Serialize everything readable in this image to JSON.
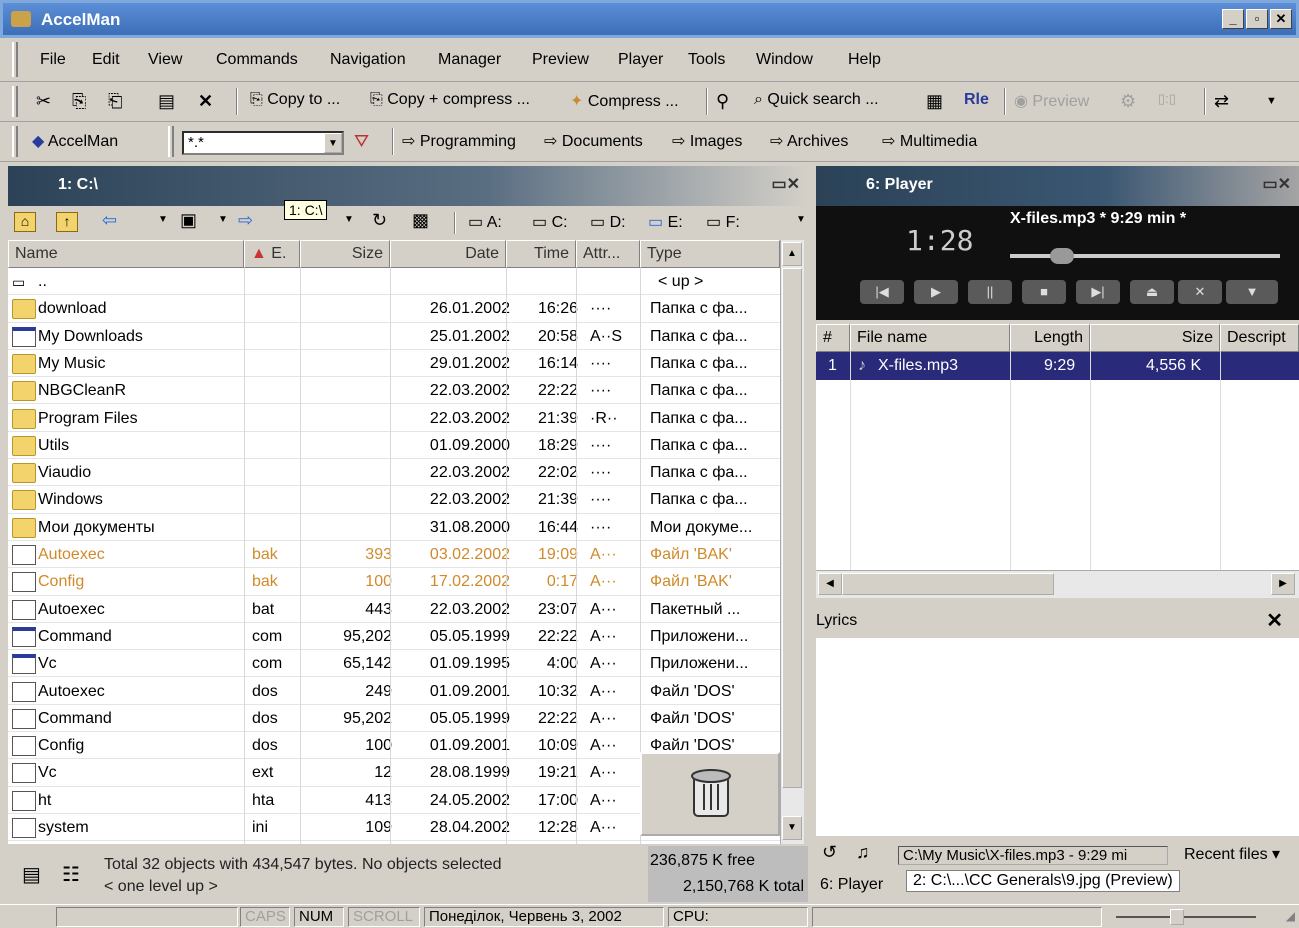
{
  "window": {
    "title": "AccelMan"
  },
  "menu": [
    "File",
    "Edit",
    "View",
    "Commands",
    "Navigation",
    "Manager",
    "Preview",
    "Player",
    "Tools",
    "Window",
    "Help"
  ],
  "toolbar1": {
    "copy_to": "Copy to ...",
    "copy_compress": "Copy + compress ...",
    "compress": "Compress ...",
    "quick_search": "Quick search ...",
    "preview": "Preview"
  },
  "toolbar2": {
    "accelman": "AccelMan",
    "filter_value": "*.*",
    "bookmarks": [
      "Programming",
      "Documents",
      "Images",
      "Archives",
      "Multimedia"
    ]
  },
  "left_panel": {
    "title": "1: C:\\",
    "path_tooltip": "1: C:\\",
    "drives": [
      "A:",
      "C:",
      "D:",
      "E:",
      "F:"
    ],
    "columns": {
      "name": "Name",
      "ext": "E.",
      "size": "Size",
      "date": "Date",
      "time": "Time",
      "attr": "Attr...",
      "type": "Type"
    },
    "up_row": {
      "name": "..",
      "type": "< up >"
    },
    "rows": [
      {
        "icon": "folder",
        "name": "download",
        "ext": "",
        "size": "",
        "date": "26.01.2002",
        "time": "16:26",
        "attr": "····",
        "type": "Папка с фа...",
        "hl": false
      },
      {
        "icon": "window",
        "name": "My Downloads",
        "ext": "",
        "size": "",
        "date": "25.01.2002",
        "time": "20:58",
        "attr": "A··S",
        "type": "Папка с фа...",
        "hl": false
      },
      {
        "icon": "folder",
        "name": "My Music",
        "ext": "",
        "size": "",
        "date": "29.01.2002",
        "time": "16:14",
        "attr": "····",
        "type": "Папка с фа...",
        "hl": false
      },
      {
        "icon": "folder",
        "name": "NBGCleanR",
        "ext": "",
        "size": "",
        "date": "22.03.2002",
        "time": "22:22",
        "attr": "····",
        "type": "Папка с фа...",
        "hl": false
      },
      {
        "icon": "folder",
        "name": "Program Files",
        "ext": "",
        "size": "",
        "date": "22.03.2002",
        "time": "21:39",
        "attr": "·R··",
        "type": "Папка с фа...",
        "hl": false
      },
      {
        "icon": "folder",
        "name": "Utils",
        "ext": "",
        "size": "",
        "date": "01.09.2000",
        "time": "18:29",
        "attr": "····",
        "type": "Папка с фа...",
        "hl": false
      },
      {
        "icon": "folder",
        "name": "Viaudio",
        "ext": "",
        "size": "",
        "date": "22.03.2002",
        "time": "22:02",
        "attr": "····",
        "type": "Папка с фа...",
        "hl": false
      },
      {
        "icon": "folder",
        "name": "Windows",
        "ext": "",
        "size": "",
        "date": "22.03.2002",
        "time": "21:39",
        "attr": "····",
        "type": "Папка с фа...",
        "hl": false
      },
      {
        "icon": "folder",
        "name": "Мои документы",
        "ext": "",
        "size": "",
        "date": "31.08.2000",
        "time": "16:44",
        "attr": "····",
        "type": "Мои докуме...",
        "hl": false
      },
      {
        "icon": "file",
        "name": "Autoexec",
        "ext": "bak",
        "size": "393",
        "date": "03.02.2002",
        "time": "19:09",
        "attr": "A···",
        "type": "Файл 'BAK'",
        "hl": true
      },
      {
        "icon": "file",
        "name": "Config",
        "ext": "bak",
        "size": "100",
        "date": "17.02.2002",
        "time": "0:17",
        "attr": "A···",
        "type": "Файл 'BAK'",
        "hl": true
      },
      {
        "icon": "file",
        "name": "Autoexec",
        "ext": "bat",
        "size": "443",
        "date": "22.03.2002",
        "time": "23:07",
        "attr": "A···",
        "type": "Пакетный ...",
        "hl": false
      },
      {
        "icon": "window",
        "name": "Command",
        "ext": "com",
        "size": "95,202",
        "date": "05.05.1999",
        "time": "22:22",
        "attr": "A···",
        "type": "Приложени...",
        "hl": false
      },
      {
        "icon": "window",
        "name": "Vc",
        "ext": "com",
        "size": "65,142",
        "date": "01.09.1995",
        "time": "4:00",
        "attr": "A···",
        "type": "Приложени...",
        "hl": false
      },
      {
        "icon": "file",
        "name": "Autoexec",
        "ext": "dos",
        "size": "249",
        "date": "01.09.2001",
        "time": "10:32",
        "attr": "A···",
        "type": "Файл 'DOS'",
        "hl": false
      },
      {
        "icon": "file",
        "name": "Command",
        "ext": "dos",
        "size": "95,202",
        "date": "05.05.1999",
        "time": "22:22",
        "attr": "A···",
        "type": "Файл 'DOS'",
        "hl": false
      },
      {
        "icon": "file",
        "name": "Config",
        "ext": "dos",
        "size": "100",
        "date": "01.09.2001",
        "time": "10:09",
        "attr": "A···",
        "type": "Файл 'DOS'",
        "hl": false
      },
      {
        "icon": "file",
        "name": "Vc",
        "ext": "ext",
        "size": "12",
        "date": "28.08.1999",
        "time": "19:21",
        "attr": "A···",
        "type": "",
        "hl": false
      },
      {
        "icon": "file",
        "name": "ht",
        "ext": "hta",
        "size": "413",
        "date": "24.05.2002",
        "time": "17:00",
        "attr": "A···",
        "type": "",
        "hl": false
      },
      {
        "icon": "file",
        "name": "system",
        "ext": "ini",
        "size": "109",
        "date": "28.04.2002",
        "time": "12:28",
        "attr": "A···",
        "type": "",
        "hl": false
      }
    ],
    "status": {
      "summary": "Total 32 objects with 434,547  bytes. No objects selected",
      "level": "< one level up >",
      "free": "236,875 K free",
      "total": "2,150,768 K total"
    }
  },
  "player": {
    "title": "6: Player",
    "time": "1:28",
    "track": "X-files.mp3 * 9:29 min *",
    "columns": {
      "num": "#",
      "file": "File name",
      "length": "Length",
      "size": "Size",
      "desc": "Descript"
    },
    "playlist": [
      {
        "num": "1",
        "file": "X-files.mp3",
        "length": "9:29",
        "size": "4,556 K"
      }
    ],
    "lyrics_label": "Lyrics",
    "status_path": "C:\\My Music\\X-files.mp3 - 9:29 mi",
    "recent_files": "Recent files",
    "tabs": [
      "6: Player",
      "2: C:\\...\\CC Generals\\9.jpg (Preview)"
    ]
  },
  "statusbar": {
    "caps": "CAPS",
    "num": "NUM",
    "scroll": "SCROLL",
    "date": "Понеділок, Червень 3, 2002",
    "cpu": "CPU:"
  },
  "colors": {
    "highlight_text": "#d08a2a",
    "selection": "#2a2a7a"
  }
}
